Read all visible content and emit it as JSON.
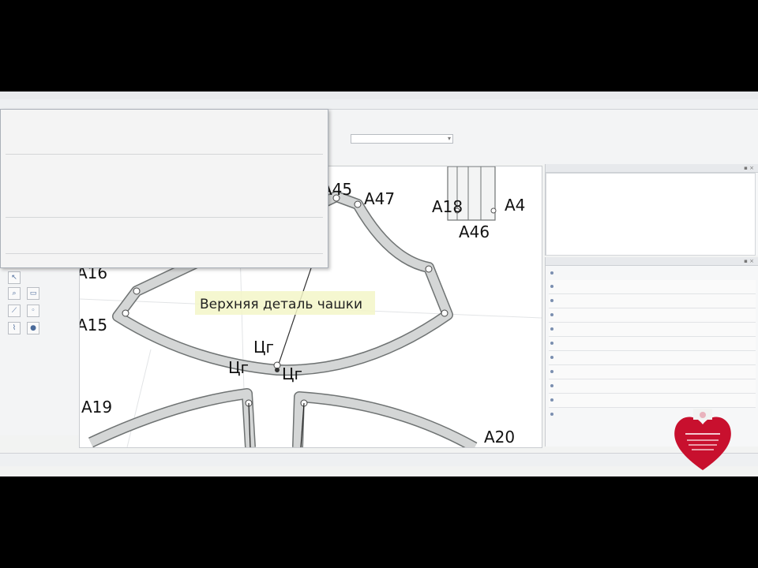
{
  "canvas": {
    "detail_title": "Верхняя деталь чашки",
    "points": {
      "a45": "A45",
      "a47": "A47",
      "a18": "A18",
      "a4x": "A4",
      "a46": "A46",
      "a16": "A16",
      "a15": "A15",
      "a19": "A19",
      "a20": "A20",
      "cg1": "Цг",
      "cg2": "Цг",
      "cg3": "Цг"
    }
  },
  "colors": {
    "pattern_fill": "#d4d6d6",
    "pattern_stroke": "#6f7373",
    "label_highlight": "#f3f6c8",
    "logo_heart": "#c8102e"
  },
  "icons": {
    "toolbar": [
      "arrow-icon",
      "zoom-icon",
      "select-icon",
      "ruler-icon",
      "point-icon",
      "line-icon"
    ],
    "logo": "heart-logo"
  }
}
